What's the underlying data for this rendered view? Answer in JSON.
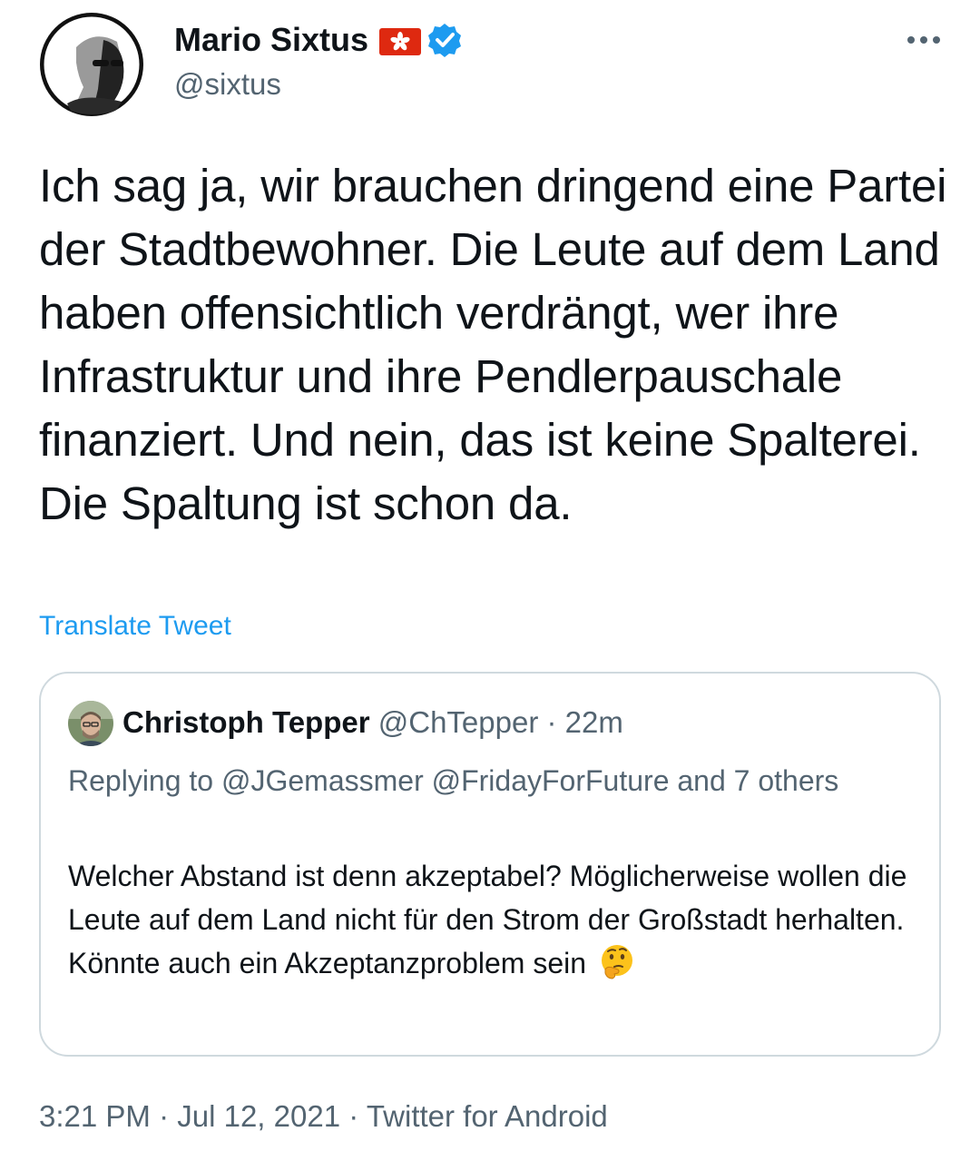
{
  "author": {
    "name": "Mario Sixtus",
    "handle": "@sixtus",
    "flag_icon": "hong-kong-flag-icon",
    "verified_icon": "verified-badge-icon"
  },
  "menu": {
    "icon": "more-options-icon"
  },
  "tweet": {
    "text": "Ich sag ja, wir brauchen dringend eine Partei der Stadtbewohner. Die Leute auf dem Land haben offensichtlich verdrängt, wer ihre Infrastruktur und ihre Pendlerpauschale finanziert. Und nein, das ist keine Spalterei. Die Spaltung ist schon da.",
    "translate_label": "Translate Tweet"
  },
  "quote": {
    "name": "Christoph Tepper",
    "handle": "@ChTepper",
    "dot": "·",
    "time": "22m",
    "replying": "Replying to @JGemassmer @FridayForFuture and 7 others",
    "text": "Welcher Abstand ist denn akzeptabel? Möglicherweise wollen die Leute auf dem Land nicht für den Strom der Großstadt herhalten. Könnte auch ein Akzeptanzproblem sein",
    "emoji_icon": "thinking-face-icon"
  },
  "footer": {
    "time": "3:21 PM",
    "sep1": "·",
    "date": "Jul 12, 2021",
    "sep2": "·",
    "source": "Twitter for Android"
  },
  "colors": {
    "accent": "#1d9bf0",
    "secondary_text": "#536471",
    "border": "#cfd9de"
  }
}
